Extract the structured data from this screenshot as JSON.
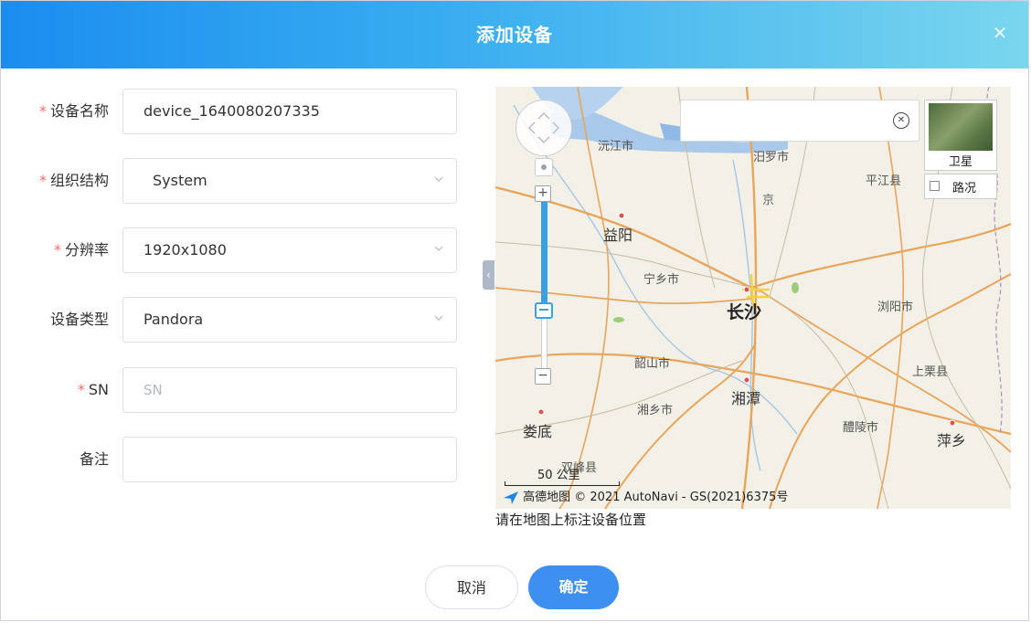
{
  "dialog": {
    "title": "添加设备",
    "close_icon": "close-icon"
  },
  "form": {
    "fields": [
      {
        "label": "设备名称",
        "required": true,
        "value": "device_1640080207335",
        "type": "input"
      },
      {
        "label": "组织结构",
        "required": true,
        "value": "System",
        "type": "select"
      },
      {
        "label": "分辨率",
        "required": true,
        "value": "1920x1080",
        "type": "select"
      },
      {
        "label": "设备类型",
        "required": false,
        "value": "Pandora",
        "type": "select"
      },
      {
        "label": "SN",
        "required": true,
        "placeholder": "SN",
        "value": "",
        "type": "input"
      },
      {
        "label": "备注",
        "required": false,
        "value": "",
        "type": "input"
      }
    ],
    "required_mark": "*"
  },
  "map": {
    "search_value": "",
    "satellite_label": "卫星",
    "traffic_label": "路况",
    "cities": [
      "沅江市",
      "汨罗市",
      "平江县",
      "益阳",
      "宁乡市",
      "长沙",
      "浏阳市",
      "韶山市",
      "湘潭",
      "湘乡市",
      "上栗县",
      "娄底",
      "醴陵市",
      "萍乡",
      "双峰县"
    ],
    "road_label": "京",
    "scale_label": "50 公里",
    "attribution": "高德地图 © 2021 AutoNavi - GS(2021)6375号",
    "caption": "请在地图上标注设备位置"
  },
  "buttons": {
    "cancel": "取消",
    "ok": "确定"
  },
  "colors": {
    "header_start": "#1b8df0",
    "header_end": "#7ad6ee",
    "primary": "#3d8ff0",
    "required": "#f56c6c"
  }
}
